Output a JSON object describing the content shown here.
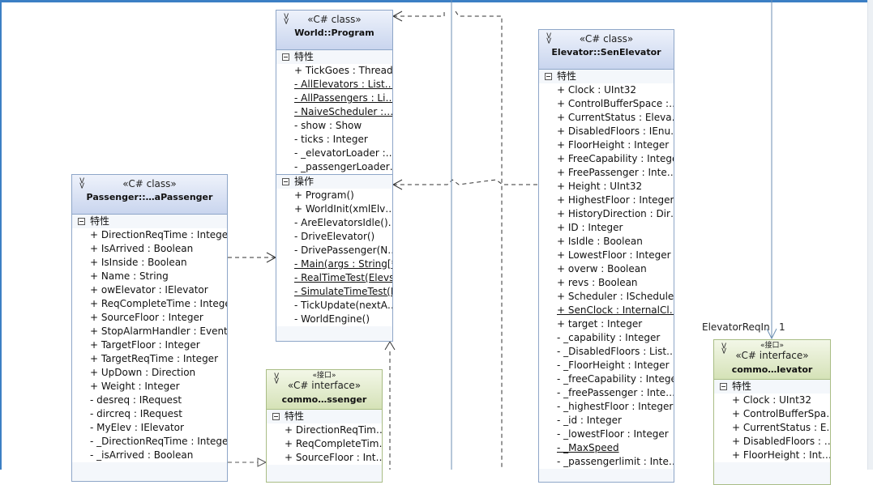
{
  "diagram": {
    "program": {
      "stereotype": "«C# class»",
      "name": "World::Program",
      "attr_title": "特性",
      "attributes": [
        "+ TickGoes : Thread",
        "- AllElevators : List…",
        "- AllPassengers : Li…",
        "- NaiveScheduler :…",
        "- show : Show",
        "- ticks : Integer",
        "- _elevatorLoader :…",
        "- _passengerLoader…"
      ],
      "op_title": "操作",
      "operations": [
        "+ Program()",
        "+ WorldInit(xmlElv…",
        "- AreElevatorsIdle()…",
        "- DriveElevator()",
        "- DrivePassenger(N…",
        "- Main(args : String[*])",
        "- RealTimeTest(Elevs…",
        "- SimulateTimeTest(El…",
        "- TickUpdate(nextA…",
        "- WorldEngine()"
      ]
    },
    "passenger": {
      "stereotype": "«C# class»",
      "name": "Passenger::…aPassenger",
      "attr_title": "特性",
      "attributes": [
        "+ DirectionReqTime : Integer",
        "+ IsArrived : Boolean",
        "+ IsInside : Boolean",
        "+ Name : String",
        "+ owElevator : IElevator",
        "+ ReqCompleteTime : Integer",
        "+ SourceFloor : Integer",
        "+ StopAlarmHandler : Event…",
        "+ TargetFloor : Integer",
        "+ TargetReqTime : Integer",
        "+ UpDown : Direction",
        "+ Weight : Integer",
        "- desreq : IRequest",
        "- dircreq : IRequest",
        "- MyElev : IElevator",
        "- _DirectionReqTime : Integer",
        "- _isArrived : Boolean"
      ]
    },
    "ipassenger": {
      "stereotype_small": "«接口»",
      "stereotype": "«C# interface»",
      "name": "commo…ssenger",
      "attr_title": "特性",
      "attributes": [
        "+ DirectionReqTim…",
        "+ ReqCompleteTim…",
        "+ SourceFloor : Int…"
      ]
    },
    "elevator": {
      "stereotype": "«C# class»",
      "name": "Elevator::SenElevator",
      "attr_title": "特性",
      "attributes": [
        "+ Clock : UInt32",
        "+ ControlBufferSpace :…",
        "+ CurrentStatus : Eleva…",
        "+ DisabledFloors : IEnu…",
        "+ FloorHeight : Integer",
        "+ FreeCapability : Integer",
        "+ FreePassenger : Inte…",
        "+ Height : UInt32",
        "+ HighestFloor : Integer",
        "+ HistoryDirection : Dir…",
        "+ ID : Integer",
        "+ IsIdle : Boolean",
        "+ LowestFloor : Integer",
        "+ overw : Boolean",
        "+ revs : Boolean",
        "+ Scheduler : IScheduler",
        "+ SenClock : InternalCl…",
        "+ target : Integer",
        "- _capability : Integer",
        "- _DisabledFloors : List…",
        "- _FloorHeight : Integer",
        "- _freeCapability : Integer",
        "- _freePassenger : Inte…",
        "- _highestFloor : Integer",
        "- _id : Integer",
        "- _lowestFloor : Integer",
        "- _MaxSpeed",
        "- _passengerlimit : Inte…"
      ]
    },
    "ielevator": {
      "stereotype_small": "«接口»",
      "stereotype": "«C# interface»",
      "name": "commo…levator",
      "attr_title": "特性",
      "attributes": [
        "+ Clock : UInt32",
        "+ ControlBufferSpa…",
        "+ CurrentStatus : E…",
        "+ DisabledFloors : …",
        "+ FloorHeight : Int…"
      ]
    },
    "labels": {
      "assoc_role": "ElevatorReqIn",
      "assoc_mult": "1"
    }
  }
}
